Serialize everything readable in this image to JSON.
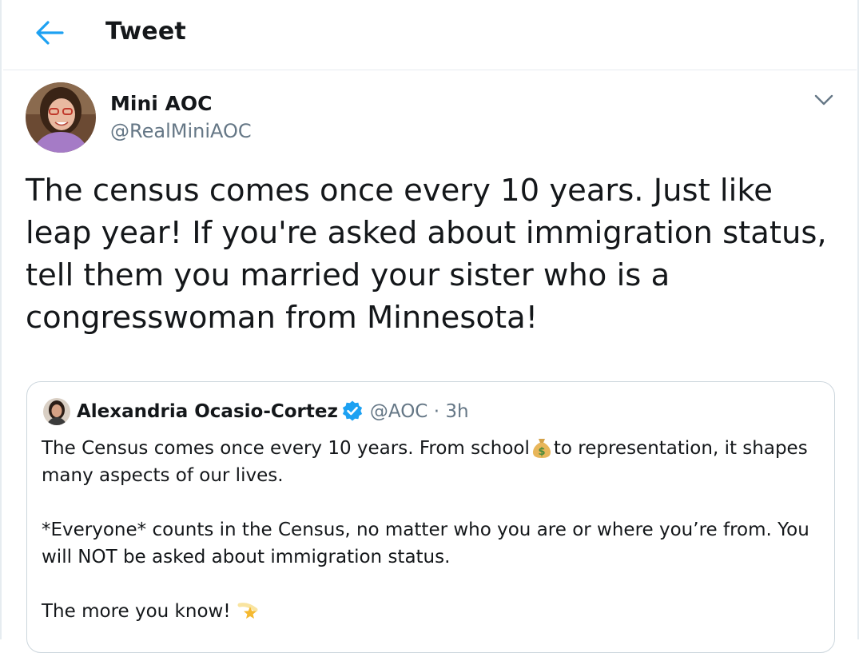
{
  "header": {
    "title": "Tweet",
    "back_icon": "arrow-left-icon",
    "accent_color": "#1da1f2"
  },
  "tweet": {
    "author_name": "Mini AOC",
    "author_handle": "@RealMiniAOC",
    "text": "The census comes once every 10 years. Just like leap year! If you're asked about immigration status, tell them you married your sister who is a congresswoman from Minnesota!",
    "menu_icon": "chevron-down-icon"
  },
  "quote": {
    "author_name": "Alexandria Ocasio-Cortez",
    "verified_icon": "verified-badge-icon",
    "handle": "@AOC",
    "separator": "·",
    "time": "3h",
    "line1_before": "The Census comes once every 10 years. From school",
    "line1_emoji": "money-bag-icon",
    "line1_after": "to representation, it shapes many aspects of our lives.",
    "para2": "*Everyone* counts in the Census, no matter who you are or where you’re from. You will NOT be asked about immigration status.",
    "para3": "The more you know!",
    "para3_emoji": "shooting-star-icon"
  }
}
